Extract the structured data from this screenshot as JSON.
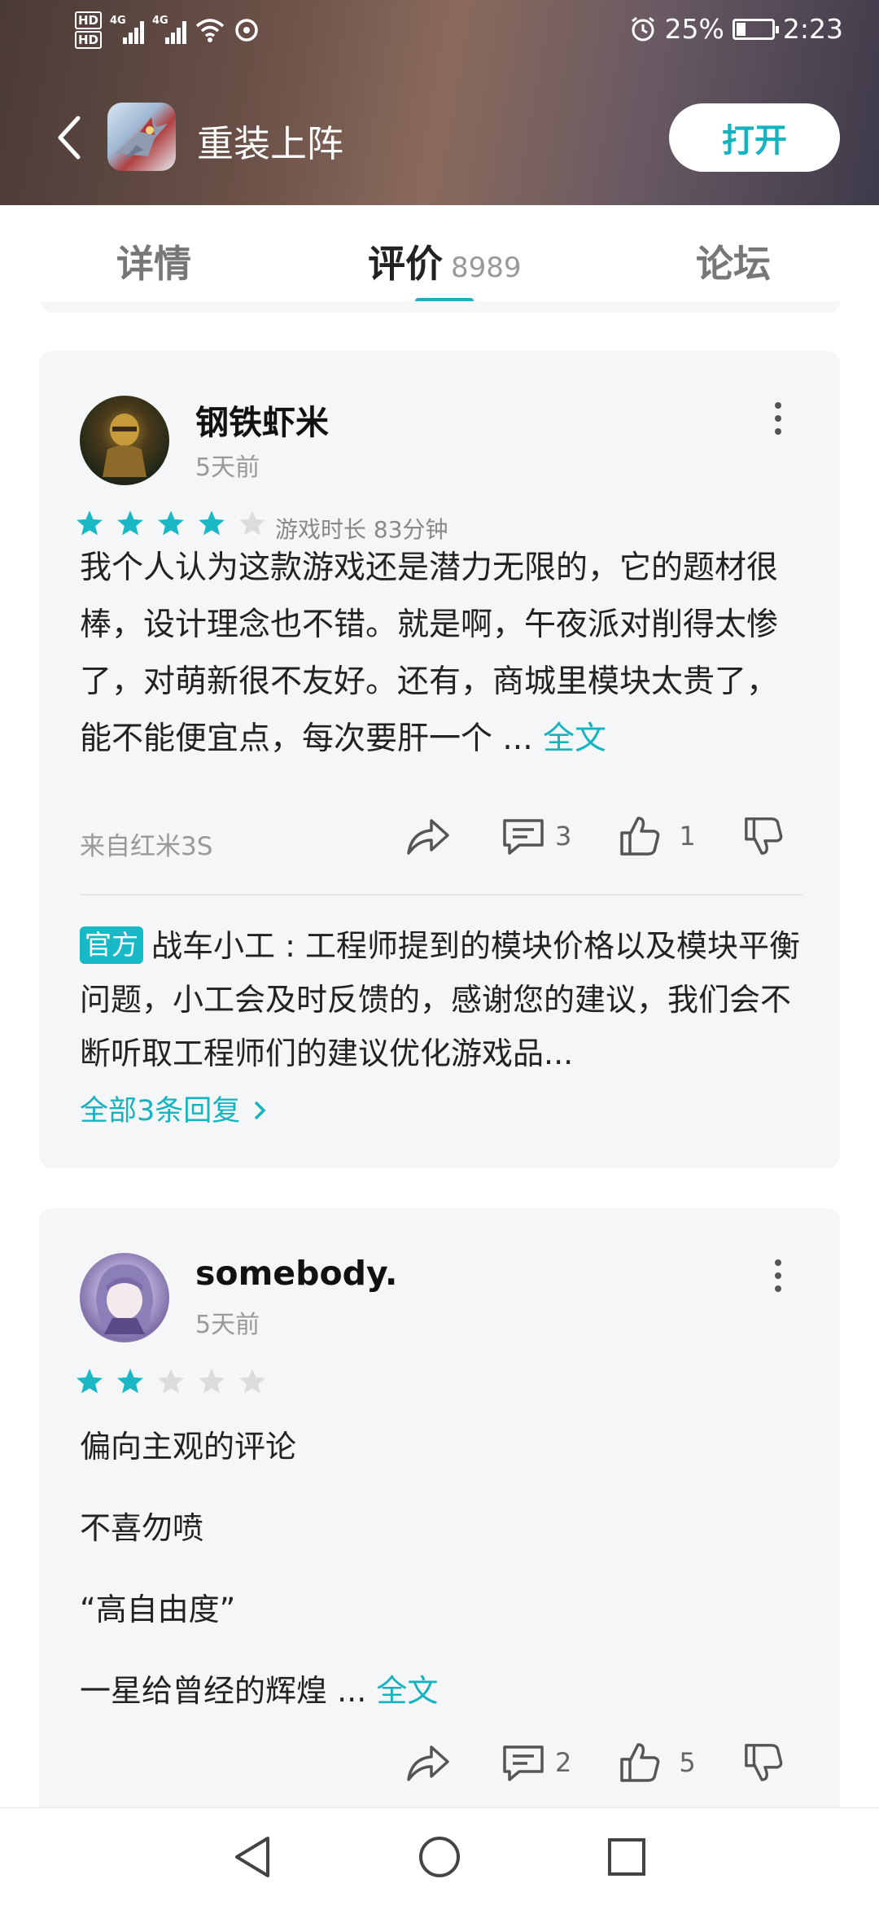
{
  "status_bar": {
    "hd1": "HD",
    "hd2": "HD",
    "net1": "4G",
    "net2": "4G",
    "battery_text": "25%",
    "battery_level": 0.25,
    "time": "2:23"
  },
  "header": {
    "app_title": "重装上阵",
    "open_button": "打开"
  },
  "tabs": {
    "details": "详情",
    "reviews": "评价",
    "reviews_count": "8989",
    "forum": "论坛",
    "active": "reviews"
  },
  "reviews": [
    {
      "username": "钢铁虾米",
      "time": "5天前",
      "rating": 4,
      "max_rating": 5,
      "playtime": "游戏时长 83分钟",
      "body_text": "我个人认为这款游戏还是潜力无限的，它的题材很棒，设计理念也不错。就是啊，午夜派对削得太惨了，对萌新很不友好。还有，商城里模块太贵了，能不能便宜点，每次要肝一个 ...",
      "expand_label": "全文",
      "source": "来自红米3S",
      "comment_count": "3",
      "like_count": "1",
      "official_badge": "官方",
      "reply_text": "战车小工 : 工程师提到的模块价格以及模块平衡问题，小工会及时反馈的，感谢您的建议，我们会不断听取工程师们的建议优化游戏品...",
      "all_replies_label": "全部3条回复"
    },
    {
      "username": "somebody.",
      "time": "5天前",
      "rating": 2,
      "max_rating": 5,
      "line1": "偏向主观的评论",
      "line2": "不喜勿喷",
      "line3": "“高自由度”",
      "line4": "一星给曾经的辉煌 ...",
      "expand_label": "全文",
      "comment_count": "2",
      "like_count": "5"
    }
  ],
  "colors": {
    "accent": "#14b3bf",
    "star_filled": "#1ab8c4",
    "star_empty": "#dcdcdc",
    "card_bg": "#f5f6f8"
  },
  "icons": [
    "back-arrow-icon",
    "share-icon",
    "comment-icon",
    "thumb-up-icon",
    "thumb-down-icon",
    "more-vert-icon",
    "chevron-right-icon",
    "nav-back-icon",
    "nav-home-icon",
    "nav-recents-icon",
    "alarm-icon",
    "wifi-icon",
    "battery-icon"
  ]
}
